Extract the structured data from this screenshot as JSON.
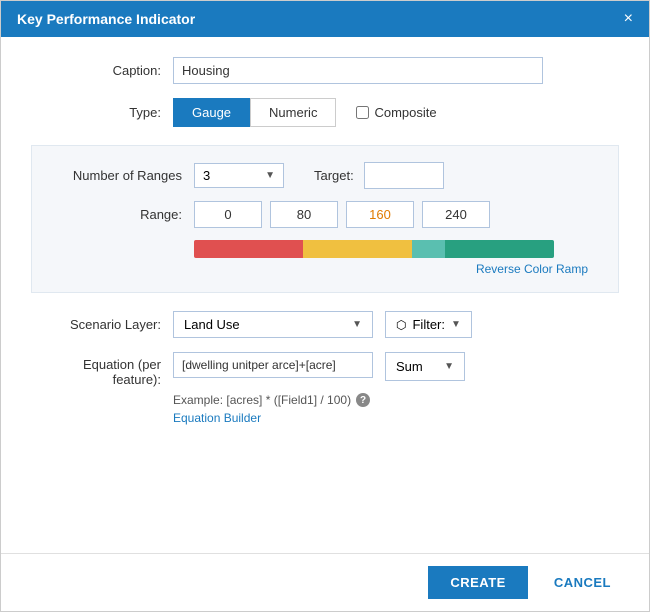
{
  "dialog": {
    "title": "Key Performance Indicator",
    "close_label": "×"
  },
  "caption": {
    "label": "Caption:",
    "value": "Housing",
    "placeholder": "Housing"
  },
  "type": {
    "label": "Type:",
    "gauge_label": "Gauge",
    "numeric_label": "Numeric",
    "composite_label": "Composite"
  },
  "ranges": {
    "number_label": "Number of Ranges",
    "number_value": "3",
    "target_label": "Target:",
    "range_label": "Range:",
    "range_values": [
      "0",
      "80",
      "160",
      "240"
    ],
    "reverse_label": "Reverse Color Ramp"
  },
  "scenario": {
    "label": "Scenario Layer:",
    "value": "Land Use",
    "filter_label": "Filter:"
  },
  "equation": {
    "label": "Equation (per feature):",
    "value": "[dwelling unitper arce]+[acre]",
    "hint": "Example: [acres] * ([Field1] / 100)",
    "builder_label": "Equation Builder",
    "sum_label": "Sum"
  },
  "footer": {
    "create_label": "CREATE",
    "cancel_label": "CANCEL"
  }
}
